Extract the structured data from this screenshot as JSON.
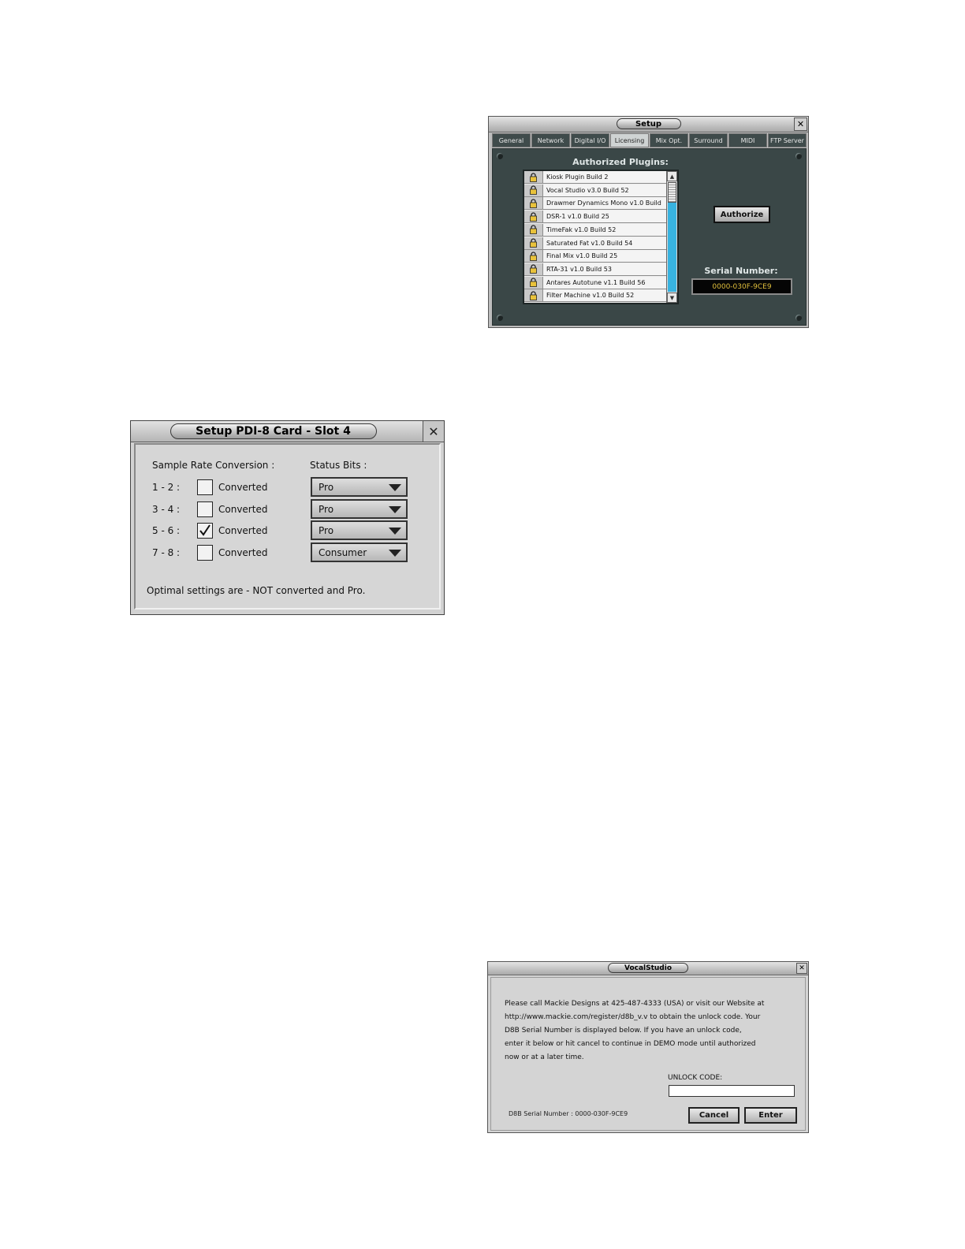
{
  "setup_window": {
    "title": "Setup",
    "tabs": [
      {
        "label": "General"
      },
      {
        "label": "Network"
      },
      {
        "label": "Digital I/O"
      },
      {
        "label": "Licensing",
        "active": true
      },
      {
        "label": "Mix Opt."
      },
      {
        "label": "Surround"
      },
      {
        "label": "MIDI"
      },
      {
        "label": "FTP Server"
      }
    ],
    "authorized_plugins_label": "Authorized Plugins:",
    "plugins": [
      "Kiosk Plugin Build 2",
      "Vocal Studio v3.0 Build 52",
      "Drawmer Dynamics Mono v1.0 Build",
      "DSR-1 v1.0 Build 25",
      "TimeFak v1.0 Build 52",
      "Saturated Fat v1.0 Build 54",
      "Final Mix v1.0 Build 25",
      "RTA-31 v1.0 Build 53",
      "Antares Autotune v1.1 Build 56",
      "Filter Machine v1.0 Build 52"
    ],
    "authorize_button": "Authorize",
    "serial_label": "Serial Number:",
    "serial_value": "0000-030F-9CE9",
    "colors": {
      "panel": "#3a4747",
      "scroll_track": "#38b3e0",
      "serial_text": "#e0bf3c"
    }
  },
  "pdi_window": {
    "title": "Setup PDI-8 Card - Slot 4",
    "src_label": "Sample Rate Conversion :",
    "status_label": "Status Bits :",
    "rows": [
      {
        "channels": "1 - 2 :",
        "converted_label": "Converted",
        "checked": false,
        "status": "Pro"
      },
      {
        "channels": "3 - 4 :",
        "converted_label": "Converted",
        "checked": false,
        "status": "Pro"
      },
      {
        "channels": "5 - 6 :",
        "converted_label": "Converted",
        "checked": true,
        "status": "Pro"
      },
      {
        "channels": "7 - 8 :",
        "converted_label": "Converted",
        "checked": false,
        "status": "Consumer"
      }
    ],
    "footer": "Optimal settings are -  NOT converted and Pro."
  },
  "vocalstudio_window": {
    "title": "VocalStudio",
    "message_lines": [
      "Please call Mackie Designs at 425-487-4333 (USA) or visit our Website at",
      "http://www.mackie.com/register/d8b_v.v to obtain the unlock code. Your",
      "D8B Serial Number is displayed below. If you have an unlock code,",
      "enter it below or hit cancel to continue in DEMO mode until authorized",
      "now or at a later time."
    ],
    "unlock_label": "UNLOCK CODE:",
    "unlock_value": "",
    "serial_line": "D8B Serial Number :  0000-030F-9CE9",
    "cancel_button": "Cancel",
    "enter_button": "Enter"
  }
}
